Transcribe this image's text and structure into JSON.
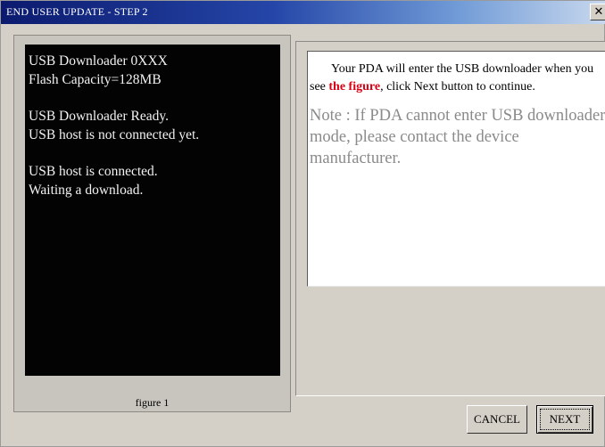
{
  "window": {
    "title": "END USER UPDATE - STEP 2",
    "close_glyph": "✕"
  },
  "device_screen": {
    "lines_group1": [
      "USB Downloader 0XXX",
      "Flash Capacity=128MB"
    ],
    "lines_group2": [
      "USB Downloader Ready.",
      "USB host is not connected yet."
    ],
    "lines_group3": [
      "USB host is connected.",
      "Waiting a download."
    ],
    "caption": "figure 1"
  },
  "instructions": {
    "text_before": "Your PDA will enter the USB downloader when you see ",
    "highlight": "the figure",
    "text_after": ", click Next button to continue.",
    "note": "Note : If PDA cannot enter USB downloader mode, please contact the device manufacturer.",
    "highlight_color": "#d80012"
  },
  "buttons": {
    "cancel": "CANCEL",
    "next": "NEXT"
  }
}
